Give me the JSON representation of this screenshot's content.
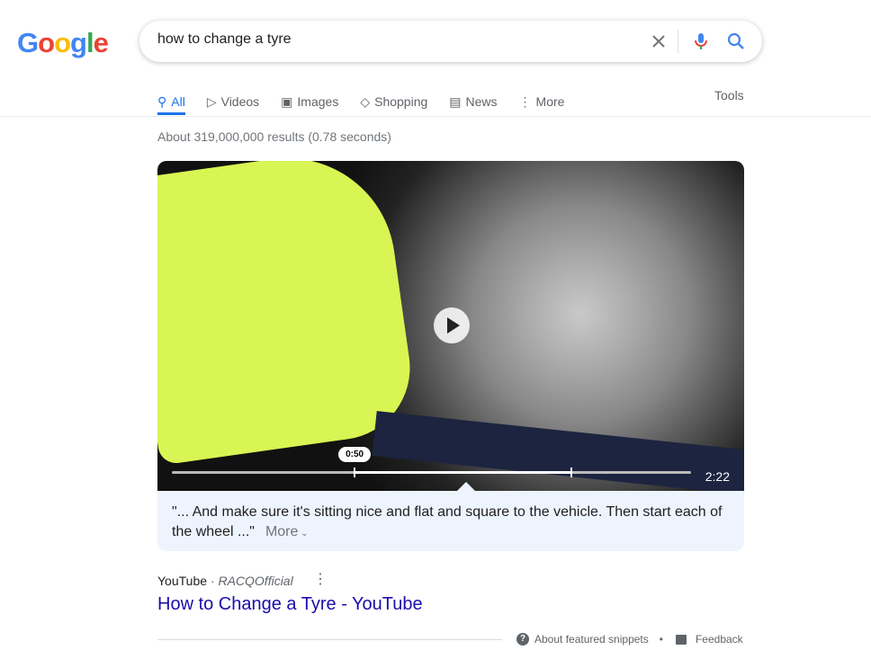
{
  "logo": "Google",
  "search": {
    "query": "how to change a tyre"
  },
  "tabs": [
    {
      "label": "All"
    },
    {
      "label": "Videos"
    },
    {
      "label": "Images"
    },
    {
      "label": "Shopping"
    },
    {
      "label": "News"
    },
    {
      "label": "More"
    }
  ],
  "tools": "Tools",
  "stats": "About 319,000,000 results (0.78 seconds)",
  "video": {
    "current_time": "0:50",
    "duration": "2:22",
    "progress_fraction": 0.352,
    "highlight_end_fraction": 0.77
  },
  "snippet": {
    "quote": "\"... And make sure it's sitting nice and flat and square to the vehicle. Then start each of the wheel ...\"",
    "more": "More"
  },
  "result": {
    "source": "YouTube",
    "channel": "RACQOfficial",
    "title": "How to Change a Tyre - YouTube",
    "link_color": "#1a0dab"
  },
  "footer": {
    "about": "About featured snippets",
    "feedback": "Feedback"
  },
  "accent": "#1a73e8"
}
